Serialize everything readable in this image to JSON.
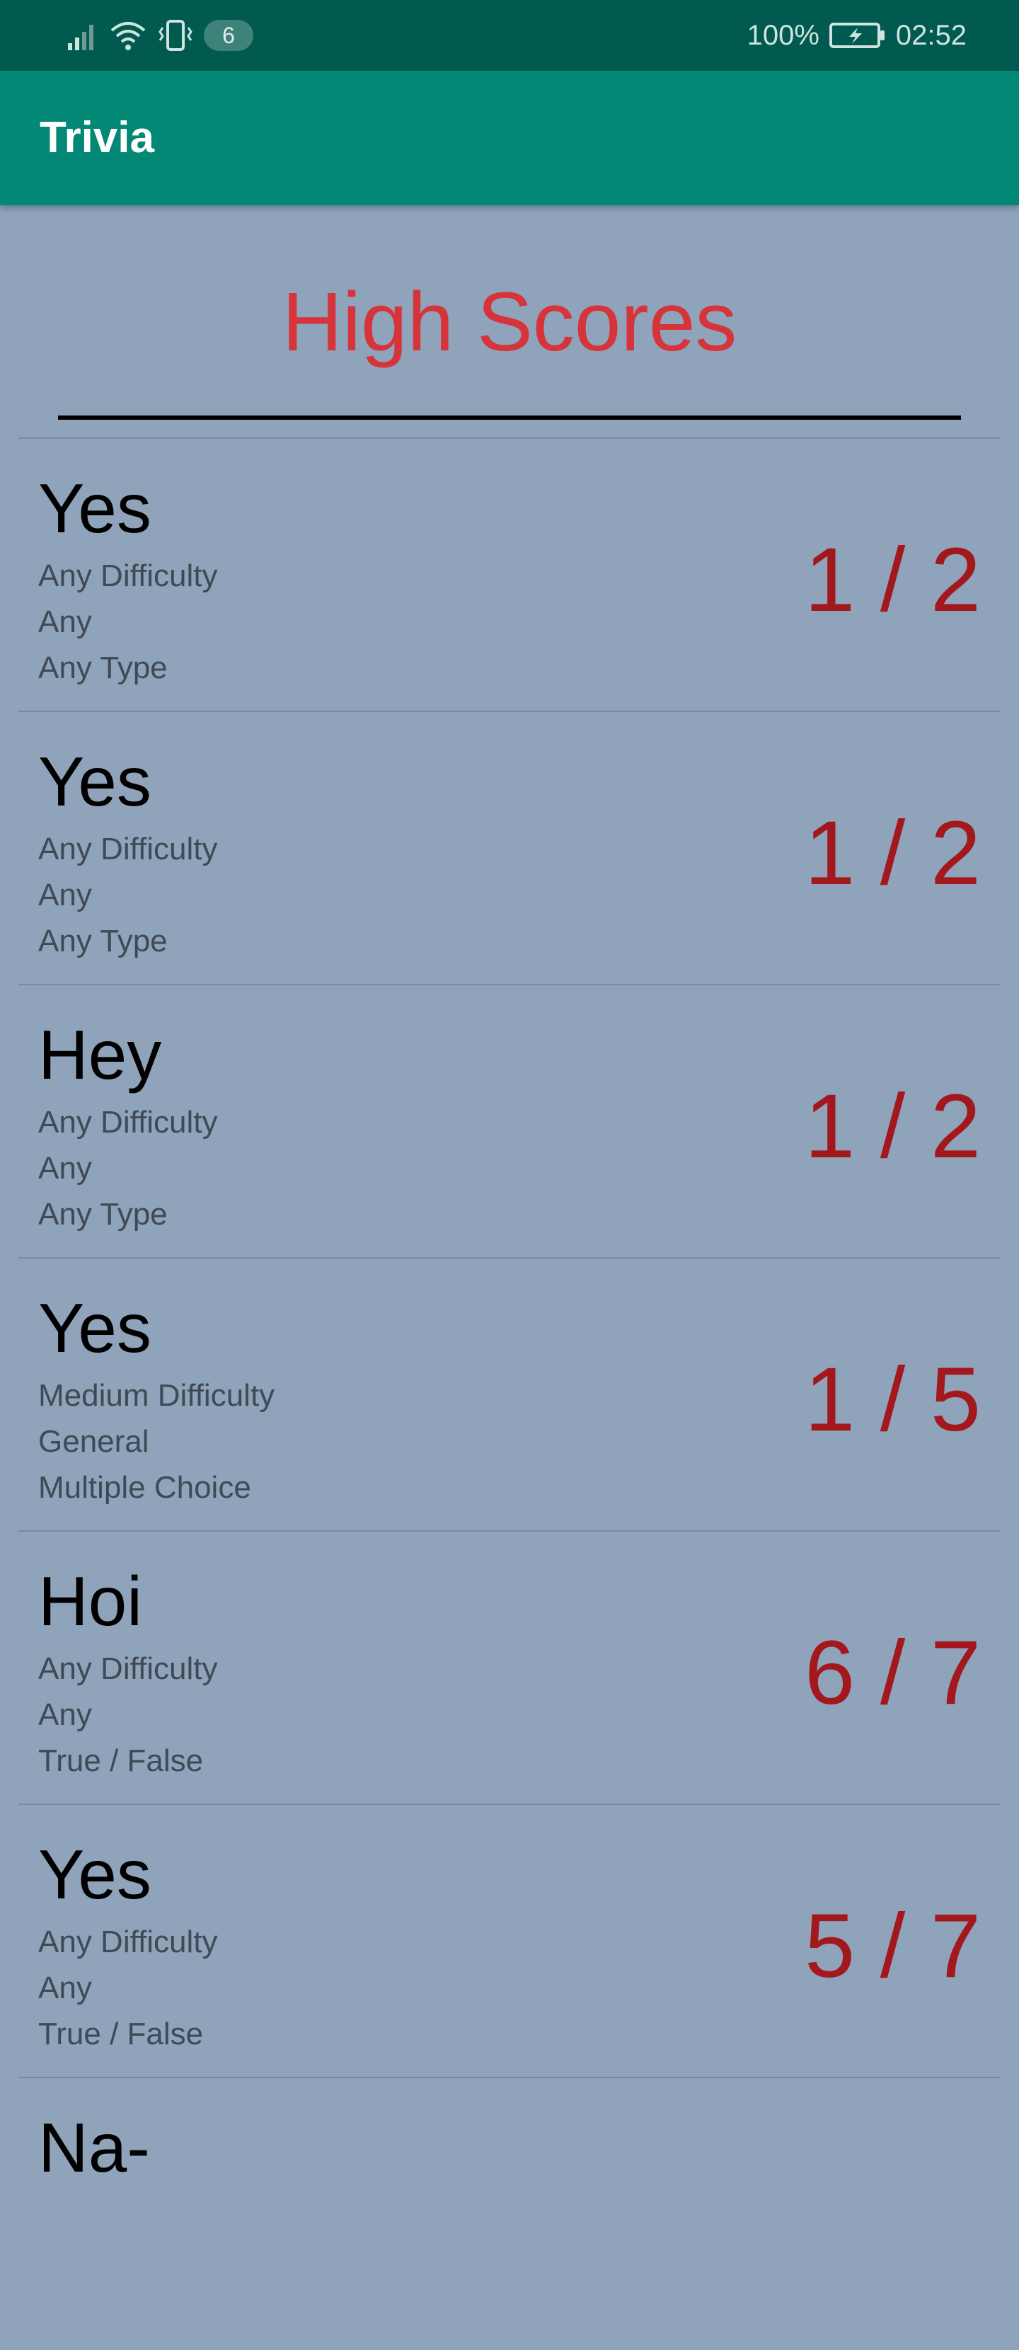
{
  "status_bar": {
    "notification_count": "6",
    "battery": "100%",
    "time": "02:52",
    "icons": [
      "signal-icon",
      "wifi-icon",
      "vibrate-icon",
      "battery-charging-icon"
    ]
  },
  "app_bar": {
    "title": "Trivia"
  },
  "page": {
    "heading": "High Scores"
  },
  "scores": [
    {
      "name": "Yes",
      "difficulty": "Any Difficulty",
      "category": "Any",
      "type": "Any Type",
      "score": "1 / 2"
    },
    {
      "name": "Yes",
      "difficulty": "Any Difficulty",
      "category": "Any",
      "type": "Any Type",
      "score": "1 / 2"
    },
    {
      "name": "Hey",
      "difficulty": "Any Difficulty",
      "category": "Any",
      "type": "Any Type",
      "score": "1 / 2"
    },
    {
      "name": "Yes",
      "difficulty": "Medium Difficulty",
      "category": "General",
      "type": "Multiple Choice",
      "score": "1 / 5"
    },
    {
      "name": "Hoi",
      "difficulty": "Any Difficulty",
      "category": "Any",
      "type": "True / False",
      "score": "6 / 7"
    },
    {
      "name": "Yes",
      "difficulty": "Any Difficulty",
      "category": "Any",
      "type": "True / False",
      "score": "5 / 7"
    },
    {
      "name": "Na-",
      "difficulty": "",
      "category": "",
      "type": "",
      "score": ""
    }
  ],
  "colors": {
    "status_bar": "#015a4f",
    "app_bar": "#028874",
    "background": "#8fa3ba",
    "heading": "#d6343a",
    "score": "#a3181d"
  }
}
